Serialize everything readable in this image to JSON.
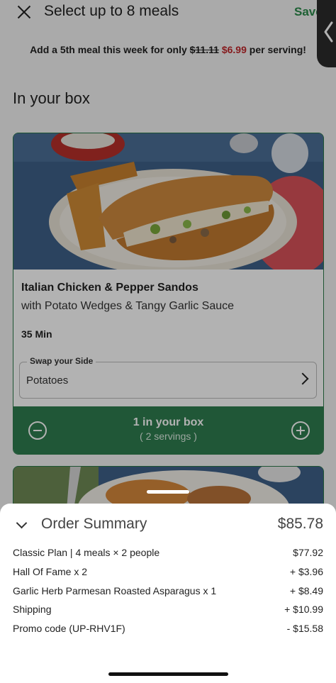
{
  "header": {
    "title": "Select up to 8 meals",
    "save_label": "Save",
    "close_icon": "close-icon",
    "side_tab_icon": "chevron-left-icon"
  },
  "promo": {
    "prefix": "Add a 5th meal this week for only ",
    "old_price": "$11.11",
    "new_price": "$6.99",
    "suffix": " per serving!"
  },
  "section_title": "In your box",
  "card": {
    "title": "Italian Chicken & Pepper Sandos",
    "subtitle": "with Potato Wedges & Tangy Garlic Sauce",
    "time": "35 Min",
    "swap_label": "Swap your Side",
    "swap_value": "Potatoes",
    "in_box": "1 in your box",
    "servings": "( 2 servings )"
  },
  "order_summary": {
    "title": "Order Summary",
    "total": "$85.78",
    "lines": [
      {
        "label": "Classic Plan | 4 meals × 2 people",
        "amount": "$77.92"
      },
      {
        "label": "Hall Of Fame x 2",
        "amount": "+ $3.96"
      },
      {
        "label": "Garlic Herb Parmesan Roasted Asparagus x 1",
        "amount": "+ $8.49"
      },
      {
        "label": "Shipping",
        "amount": "+ $10.99"
      },
      {
        "label": "Promo code (UP-RHV1F)",
        "amount": "- $15.58"
      }
    ]
  },
  "colors": {
    "accent_green": "#2e7d4f",
    "sale_red": "#c0282c"
  }
}
